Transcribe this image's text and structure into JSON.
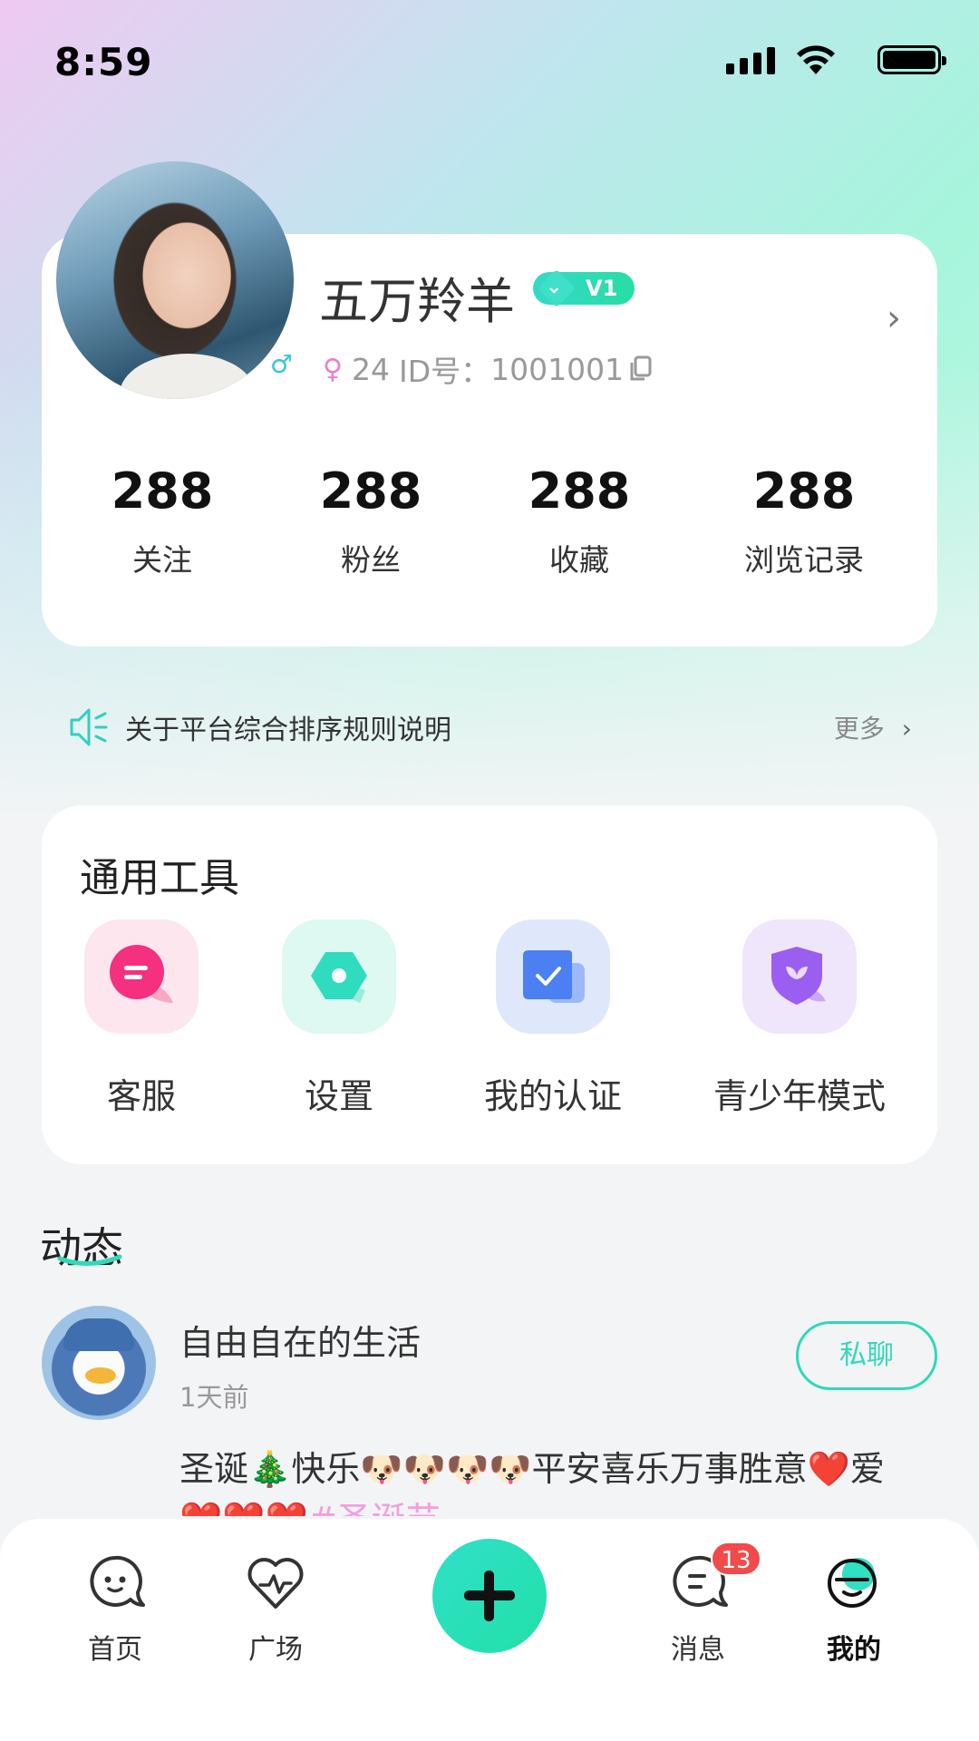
{
  "status_bar": {
    "time": "8:59"
  },
  "profile": {
    "nickname": "五万羚羊",
    "vip_level": "V1",
    "male_symbol": "♂",
    "female_symbol": "♀",
    "age": "24",
    "id_label": "ID号：",
    "id_value": "1001001",
    "stats": [
      {
        "value": "288",
        "label": "关注"
      },
      {
        "value": "288",
        "label": "粉丝"
      },
      {
        "value": "288",
        "label": "收藏"
      },
      {
        "value": "288",
        "label": "浏览记录"
      }
    ]
  },
  "notice": {
    "text": "关于平台综合排序规则说明",
    "more_label": "更多"
  },
  "tools": {
    "title": "通用工具",
    "items": [
      {
        "label": "客服",
        "icon": "customer-service-icon",
        "color": "#f4307f"
      },
      {
        "label": "设置",
        "icon": "settings-icon",
        "color": "#2fdcbe"
      },
      {
        "label": "我的认证",
        "icon": "verification-icon",
        "color": "#4c7ff2"
      },
      {
        "label": "青少年模式",
        "icon": "teen-mode-shield-icon",
        "color": "#9a5ff0"
      }
    ]
  },
  "feed": {
    "title": "动态",
    "post": {
      "author": "自由自在的生活",
      "time": "1天前",
      "chat_label": "私聊",
      "text": "圣诞🎄快乐🐶🐶🐶🐶平安喜乐万事胜意❤️爱",
      "text_line2": "❤️❤️❤️",
      "hashtag": "#圣诞节"
    }
  },
  "bottom_nav": {
    "items": [
      {
        "label": "首页",
        "icon": "home-chat-face-icon"
      },
      {
        "label": "广场",
        "icon": "heart-pulse-icon"
      },
      {
        "label": "消息",
        "icon": "message-icon"
      },
      {
        "label": "我的",
        "icon": "profile-face-icon"
      }
    ],
    "message_badge": "13",
    "active": "我的"
  },
  "colors": {
    "accent": "#2fd9b9",
    "badge": "#f24a4a",
    "hashtag": "#f2a0dc"
  }
}
